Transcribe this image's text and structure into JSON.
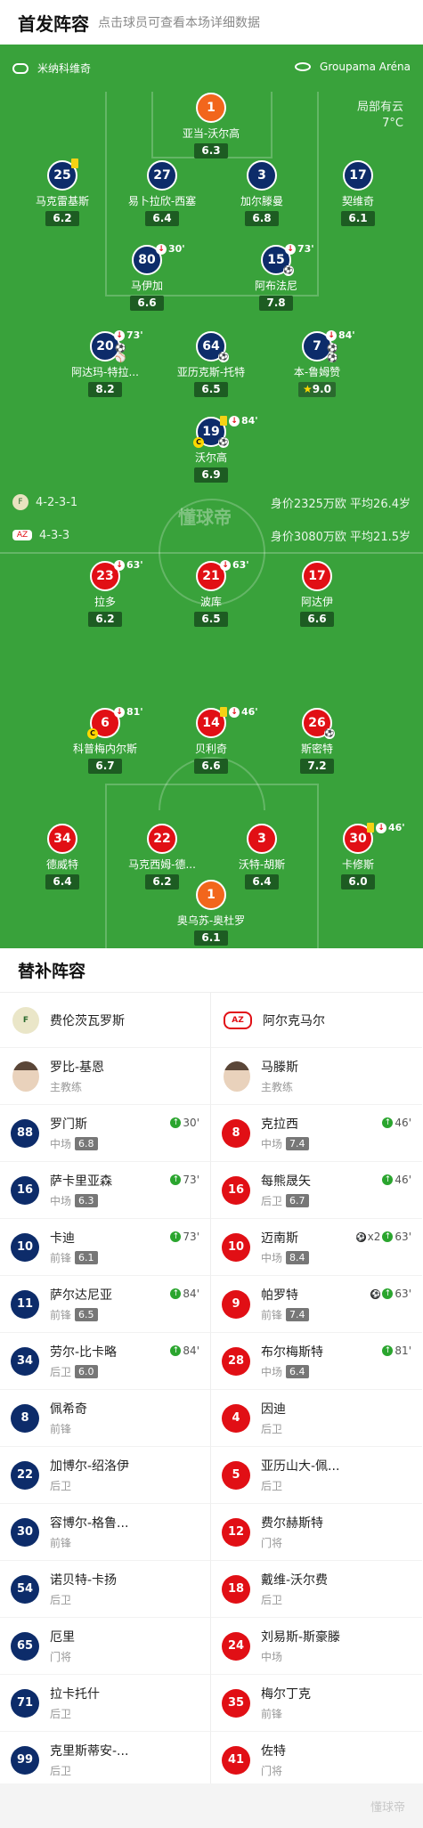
{
  "header": {
    "title": "首发阵容",
    "subtitle": "点击球员可查看本场详细数据"
  },
  "pitch": {
    "home_team": "米纳科维奇",
    "venue": "Groupama Aréna",
    "weather": "局部有云",
    "temperature": "7°C",
    "watermark": "懂球帝",
    "home_formation": "4-2-3-1",
    "home_value": "身价2325万欧 平均26.4岁",
    "away_formation": "4-3-3",
    "away_value": "身价3080万欧 平均21.5岁"
  },
  "home_lineup": [
    {
      "num": "1",
      "name": "亚当-沃尔高",
      "rating": "6.3"
    },
    {
      "num": "25",
      "name": "马克雷基斯",
      "rating": "6.2",
      "yellow": true
    },
    {
      "num": "27",
      "name": "易卜拉欣-西塞",
      "rating": "6.4"
    },
    {
      "num": "3",
      "name": "加尔滕曼",
      "rating": "6.8"
    },
    {
      "num": "17",
      "name": "契维奇",
      "rating": "6.1"
    },
    {
      "num": "80",
      "name": "马伊加",
      "rating": "6.6",
      "event": "30'"
    },
    {
      "num": "15",
      "name": "阿布法尼",
      "rating": "7.8",
      "event": "73'"
    },
    {
      "num": "20",
      "name": "阿达玛-特拉...",
      "rating": "8.2",
      "event": "73'"
    },
    {
      "num": "64",
      "name": "亚历克斯-托特",
      "rating": "6.5"
    },
    {
      "num": "7",
      "name": "本-鲁姆赞",
      "rating": "9.0",
      "event": "84'"
    },
    {
      "num": "19",
      "name": "沃尔高",
      "rating": "6.9",
      "event": "84'"
    }
  ],
  "away_lineup": [
    {
      "num": "23",
      "name": "拉多",
      "rating": "6.2",
      "event": "63'"
    },
    {
      "num": "21",
      "name": "波库",
      "rating": "6.5",
      "event": "63'"
    },
    {
      "num": "17",
      "name": "阿达伊",
      "rating": "6.6"
    },
    {
      "num": "6",
      "name": "科普梅内尔斯",
      "rating": "6.7",
      "event": "81'"
    },
    {
      "num": "14",
      "name": "贝利奇",
      "rating": "6.6",
      "event": "46'"
    },
    {
      "num": "26",
      "name": "斯密特",
      "rating": "7.2"
    },
    {
      "num": "34",
      "name": "德威特",
      "rating": "6.4"
    },
    {
      "num": "22",
      "name": "马克西姆-德...",
      "rating": "6.2"
    },
    {
      "num": "3",
      "name": "沃特-胡斯",
      "rating": "6.4"
    },
    {
      "num": "30",
      "name": "卡修斯",
      "rating": "6.0",
      "event": "46'"
    },
    {
      "num": "1",
      "name": "奥乌苏-奥杜罗",
      "rating": "6.1"
    }
  ],
  "subs": {
    "title": "替补阵容",
    "home": {
      "team": "费伦茨瓦罗斯",
      "coach": {
        "name": "罗比-基恩",
        "role": "主教练"
      },
      "players": [
        {
          "num": "88",
          "name": "罗门斯",
          "pos": "中场",
          "rating": "6.8",
          "min": "30'"
        },
        {
          "num": "16",
          "name": "萨卡里亚森",
          "pos": "中场",
          "rating": "6.3",
          "min": "73'"
        },
        {
          "num": "10",
          "name": "卡迪",
          "pos": "前锋",
          "rating": "6.1",
          "min": "73'"
        },
        {
          "num": "11",
          "name": "萨尔达尼亚",
          "pos": "前锋",
          "rating": "6.5",
          "min": "84'"
        },
        {
          "num": "34",
          "name": "劳尔-比卡略",
          "pos": "后卫",
          "rating": "6.0",
          "min": "84'"
        },
        {
          "num": "8",
          "name": "佩希奇",
          "pos": "前锋"
        },
        {
          "num": "22",
          "name": "加博尔-绍洛伊",
          "pos": "后卫"
        },
        {
          "num": "30",
          "name": "容博尔-格鲁...",
          "pos": "前锋"
        },
        {
          "num": "54",
          "name": "诺贝特-卡扬",
          "pos": "后卫"
        },
        {
          "num": "65",
          "name": "厄里",
          "pos": "门将"
        },
        {
          "num": "71",
          "name": "拉卡托什",
          "pos": "后卫"
        },
        {
          "num": "99",
          "name": "克里斯蒂安-...",
          "pos": "后卫"
        }
      ]
    },
    "away": {
      "team": "阿尔克马尔",
      "coach": {
        "name": "马滕斯",
        "role": "主教练"
      },
      "players": [
        {
          "num": "8",
          "name": "克拉西",
          "pos": "中场",
          "rating": "7.4",
          "min": "46'"
        },
        {
          "num": "16",
          "name": "每熊晟矢",
          "pos": "后卫",
          "rating": "6.7",
          "min": "46'"
        },
        {
          "num": "10",
          "name": "迈南斯",
          "pos": "中场",
          "rating": "8.4",
          "min": "63'",
          "goals": "x2"
        },
        {
          "num": "9",
          "name": "帕罗特",
          "pos": "前锋",
          "rating": "7.4",
          "min": "63'",
          "goal": true
        },
        {
          "num": "28",
          "name": "布尔梅斯特",
          "pos": "中场",
          "rating": "6.4",
          "min": "81'"
        },
        {
          "num": "4",
          "name": "因迪",
          "pos": "后卫"
        },
        {
          "num": "5",
          "name": "亚历山大-佩...",
          "pos": "后卫"
        },
        {
          "num": "12",
          "name": "费尔赫斯特",
          "pos": "门将"
        },
        {
          "num": "18",
          "name": "戴维-沃尔费",
          "pos": "后卫"
        },
        {
          "num": "24",
          "name": "刘易斯-斯豪滕",
          "pos": "中场"
        },
        {
          "num": "35",
          "name": "梅尔丁克",
          "pos": "前锋"
        },
        {
          "num": "41",
          "name": "佐特",
          "pos": "门将"
        }
      ]
    }
  },
  "footer": {
    "watermark": "懂球帝"
  }
}
